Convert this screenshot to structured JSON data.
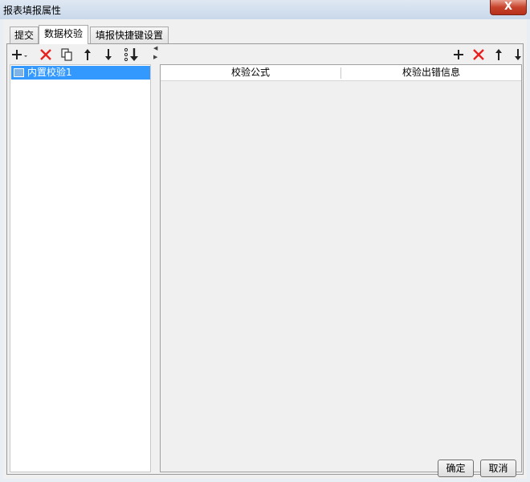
{
  "window": {
    "title": "报表填报属性",
    "close_label": "X"
  },
  "tabs": [
    {
      "label": "提交",
      "active": false
    },
    {
      "label": "数据校验",
      "active": true
    },
    {
      "label": "填报快捷键设置",
      "active": false
    }
  ],
  "left_toolbar": [
    {
      "icon": "add-dropdown-icon"
    },
    {
      "icon": "delete-icon"
    },
    {
      "icon": "copy-icon"
    },
    {
      "icon": "move-up-icon"
    },
    {
      "icon": "move-down-icon"
    },
    {
      "icon": "sort-icon"
    }
  ],
  "left_list": {
    "items": [
      {
        "label": "内置校验1",
        "selected": true,
        "icon": "validation-item-icon"
      }
    ]
  },
  "right_toolbar": [
    {
      "icon": "add-icon"
    },
    {
      "icon": "delete-icon"
    },
    {
      "icon": "move-up-icon"
    },
    {
      "icon": "move-down-icon"
    }
  ],
  "table": {
    "columns": [
      "校验公式",
      "校验出错信息"
    ],
    "rows": []
  },
  "footer": {
    "ok_label": "确定",
    "cancel_label": "取消"
  },
  "colors": {
    "selection": "#3399ff",
    "delete_red": "#e82020",
    "close_red": "#c7432b"
  }
}
